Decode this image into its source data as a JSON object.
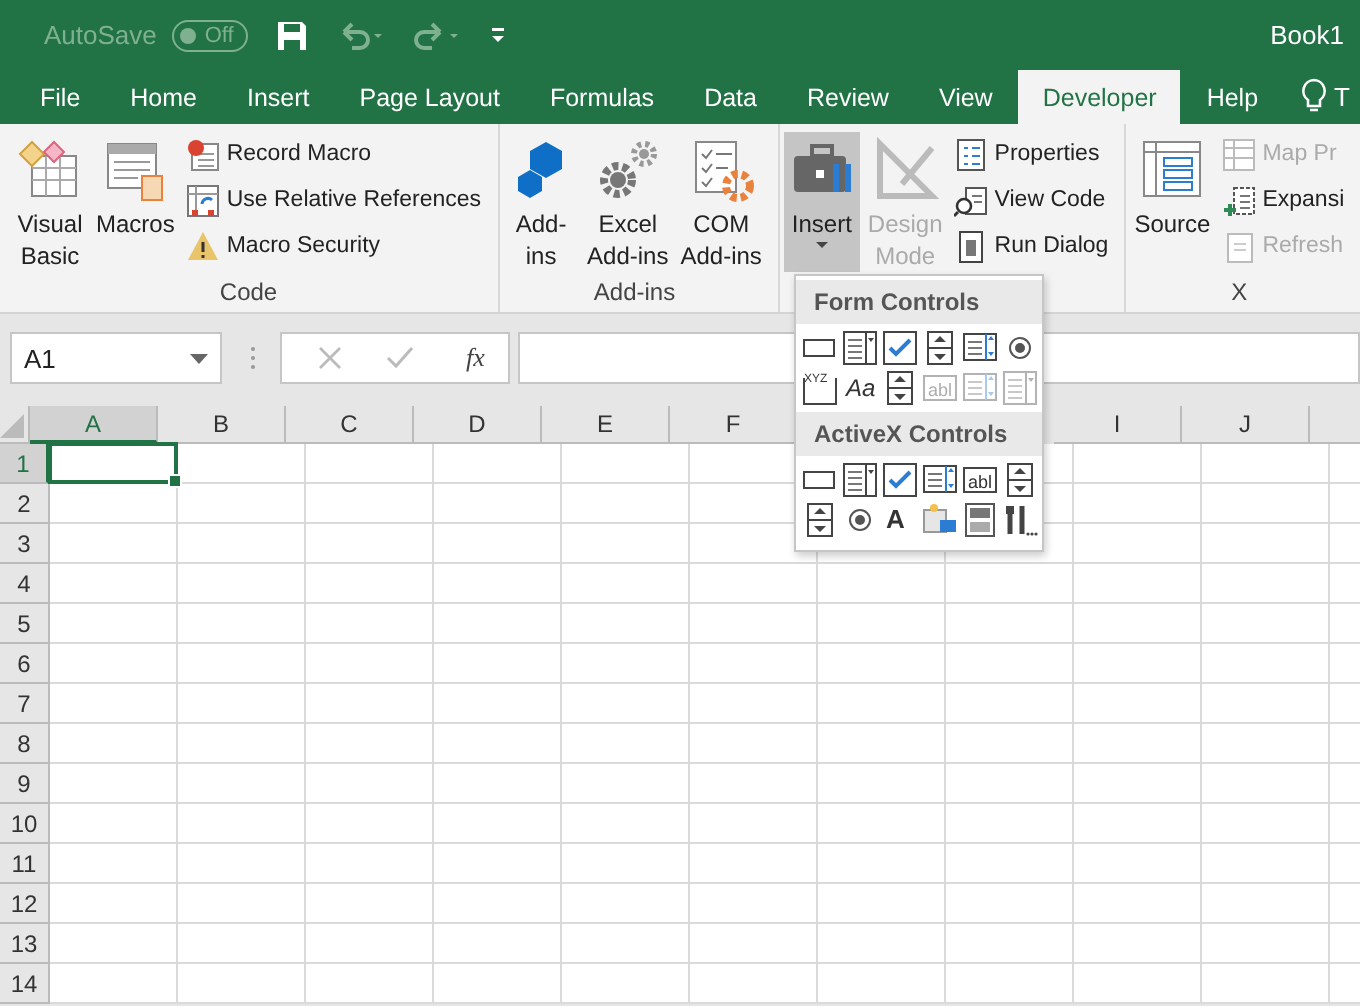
{
  "title_bar": {
    "autosave": {
      "label": "AutoSave",
      "toggle": "Off",
      "disabled": true
    },
    "book": "Book1"
  },
  "tabs": [
    {
      "label": "File",
      "selected": false
    },
    {
      "label": "Home",
      "selected": false
    },
    {
      "label": "Insert",
      "selected": false
    },
    {
      "label": "Page Layout",
      "selected": false
    },
    {
      "label": "Formulas",
      "selected": false
    },
    {
      "label": "Data",
      "selected": false
    },
    {
      "label": "Review",
      "selected": false
    },
    {
      "label": "View",
      "selected": false
    },
    {
      "label": "Developer",
      "selected": true
    },
    {
      "label": "Help",
      "selected": false
    }
  ],
  "tell_me": "T",
  "ribbon": {
    "groups": [
      {
        "label": "Code",
        "items": [
          {
            "kind": "large",
            "label": "Visual\nBasic",
            "disabled": false
          },
          {
            "kind": "large",
            "label": "Macros",
            "disabled": false
          },
          {
            "kind": "small",
            "label": "Record Macro",
            "disabled": false
          },
          {
            "kind": "small",
            "label": "Use Relative References",
            "disabled": false
          },
          {
            "kind": "small",
            "label": "Macro Security",
            "disabled": false
          }
        ]
      },
      {
        "label": "Add-ins",
        "items": [
          {
            "kind": "large",
            "label": "Add-\nins",
            "disabled": false
          },
          {
            "kind": "large",
            "label": "Excel\nAdd-ins",
            "disabled": false
          },
          {
            "kind": "large",
            "label": "COM\nAdd-ins",
            "disabled": false
          }
        ]
      },
      {
        "items": [
          {
            "kind": "large",
            "label": "Insert",
            "disabled": false,
            "pressed": true,
            "caret": true
          },
          {
            "kind": "large",
            "label": "Design\nMode",
            "disabled": true
          },
          {
            "kind": "small",
            "label": "Properties",
            "disabled": false
          },
          {
            "kind": "small",
            "label": "View Code",
            "disabled": false
          },
          {
            "kind": "small",
            "label": "Run Dialog",
            "disabled": false
          }
        ]
      },
      {
        "label": "X",
        "items": [
          {
            "kind": "large",
            "label": "Source",
            "disabled": false
          },
          {
            "kind": "small",
            "label": "Map Pr",
            "disabled": true
          },
          {
            "kind": "small",
            "label": "Expansi",
            "disabled": false
          },
          {
            "kind": "small",
            "label": "Refresh",
            "disabled": true
          }
        ]
      }
    ]
  },
  "formula_bar": {
    "name_box": "A1",
    "fx": "fx"
  },
  "grid": {
    "columns": [
      {
        "label": "A",
        "selected": true
      },
      {
        "label": "B",
        "selected": false
      },
      {
        "label": "C",
        "selected": false
      },
      {
        "label": "D",
        "selected": false
      },
      {
        "label": "E",
        "selected": false
      },
      {
        "label": "F",
        "selected": false
      },
      {},
      {},
      {
        "label": "I",
        "selected": false
      },
      {
        "label": "J",
        "selected": false
      },
      {
        "selected": false
      }
    ],
    "rows": [
      {
        "label": "1",
        "selected": true
      },
      {
        "label": "2",
        "selected": false
      },
      {
        "label": "3",
        "selected": false
      },
      {
        "label": "4",
        "selected": false
      },
      {
        "label": "5",
        "selected": false
      },
      {
        "label": "6",
        "selected": false
      },
      {
        "label": "7",
        "selected": false
      },
      {
        "label": "8",
        "selected": false
      },
      {
        "label": "9",
        "selected": false
      },
      {
        "label": "10",
        "selected": false
      },
      {
        "label": "11",
        "selected": false
      },
      {
        "label": "12",
        "selected": false
      },
      {
        "label": "13",
        "selected": false
      },
      {
        "label": "14",
        "selected": false
      }
    ]
  },
  "insert_menu": {
    "sections": [
      {
        "title": "Form Controls",
        "items": [
          {
            "disabled": false
          },
          {
            "disabled": false
          },
          {
            "disabled": false
          },
          {
            "disabled": false
          },
          {
            "disabled": false
          },
          {
            "disabled": false
          },
          {
            "disabled": false,
            "glyph": "XYZ"
          },
          {
            "disabled": false,
            "glyph": "Aa"
          },
          {
            "disabled": false
          },
          {
            "disabled": true,
            "glyph": "abl"
          },
          {
            "disabled": true
          },
          {
            "disabled": true
          }
        ]
      },
      {
        "title": "ActiveX Controls",
        "items": [
          {
            "disabled": false
          },
          {
            "disabled": false
          },
          {
            "disabled": false
          },
          {
            "disabled": false
          },
          {
            "disabled": false,
            "glyph": "abl"
          },
          {
            "disabled": false
          },
          {
            "disabled": false
          },
          {
            "disabled": false
          },
          {
            "disabled": false,
            "glyph": "A"
          },
          {
            "disabled": false
          },
          {
            "disabled": false
          },
          {
            "disabled": false
          }
        ]
      }
    ]
  }
}
